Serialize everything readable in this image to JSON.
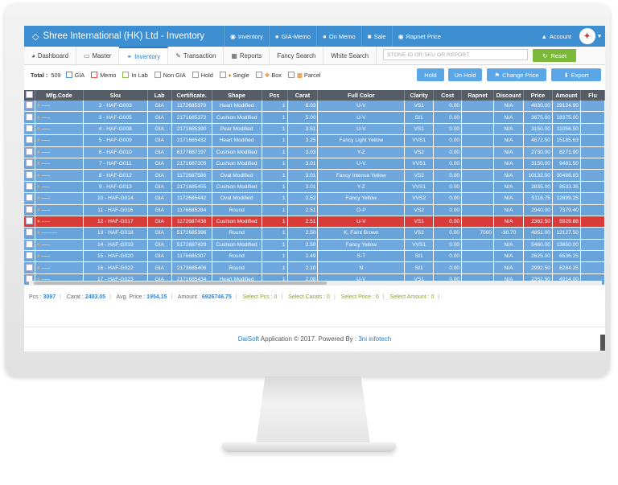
{
  "app": {
    "title": "Shree International (HK) Ltd - Inventory",
    "nav": [
      {
        "label": "Inventory",
        "icon": "eye-icon"
      },
      {
        "label": "GIA-Memo",
        "icon": "circle-icon"
      },
      {
        "label": "On Memo",
        "icon": "user-icon"
      },
      {
        "label": "Sale",
        "icon": "lock-icon"
      },
      {
        "label": "Rapnet Price",
        "icon": "eye-icon"
      }
    ],
    "account_label": "Account"
  },
  "tabs": [
    {
      "label": "Dashboard",
      "icon": "dashboard-icon",
      "active": false
    },
    {
      "label": "Master",
      "icon": "monitor-icon",
      "active": false
    },
    {
      "label": "Inventory",
      "icon": "binoculars-icon",
      "active": true
    },
    {
      "label": "Transaction",
      "icon": "edit-icon",
      "active": false
    },
    {
      "label": "Reports",
      "icon": "bar-chart-icon",
      "active": false
    },
    {
      "label": "Fancy Search",
      "icon": "",
      "active": false
    },
    {
      "label": "White Search",
      "icon": "",
      "active": false
    }
  ],
  "search": {
    "placeholder": "STONE ID OR SKU OR REPORT"
  },
  "reset_label": "Reset",
  "filters": {
    "total_label": "Total :",
    "total_value": "509",
    "checks": [
      {
        "label": "GIA",
        "color": "blue"
      },
      {
        "label": "Memo",
        "color": "red"
      },
      {
        "label": "In Lab",
        "color": "green"
      },
      {
        "label": "Non GIA",
        "color": "grey"
      },
      {
        "label": "Hold",
        "color": "grey"
      },
      {
        "label": "Single",
        "color": "grey",
        "icon": "gem"
      },
      {
        "label": "Box",
        "color": "grey",
        "icon": "box"
      },
      {
        "label": "Parcel",
        "color": "grey",
        "icon": "parcel"
      }
    ]
  },
  "actions": {
    "hold": "Hold",
    "unhold": "Un Hold",
    "change_price": "Change Price",
    "export": "Export"
  },
  "columns": [
    "Mfg.Code",
    "Sku",
    "Lab",
    "Certificate.",
    "Shape",
    "Pcs",
    "Carat",
    "Full Color",
    "Clarity",
    "Cost",
    "Rapnet",
    "Discount",
    "Price",
    "Amount",
    "Flu"
  ],
  "rows": [
    {
      "mfg": "-----",
      "sku": "2 - HAF-G003",
      "lab": "GIA",
      "cert": "1172685370",
      "shape": "Heart Modified",
      "pcs": "1",
      "carat": "6.03",
      "color": "U-V",
      "clarity": "VS1",
      "cost": "0.00",
      "rapnet": "",
      "discount": "N/A",
      "price": "4830.00",
      "amount": "29124.90",
      "hold": false
    },
    {
      "mfg": "-----",
      "sku": "3 - HAF-G005",
      "lab": "GIA",
      "cert": "2171685372",
      "shape": "Cushion Modified",
      "pcs": "1",
      "carat": "5.00",
      "color": "U-V",
      "clarity": "SI1",
      "cost": "0.00",
      "rapnet": "",
      "discount": "N/A",
      "price": "3675.00",
      "amount": "18375.00",
      "hold": false
    },
    {
      "mfg": "-----",
      "sku": "4 - HAF-G008",
      "lab": "GIA",
      "cert": "2171685390",
      "shape": "Pear Modified",
      "pcs": "1",
      "carat": "3.51",
      "color": "U-V",
      "clarity": "VS1",
      "cost": "0.00",
      "rapnet": "",
      "discount": "N/A",
      "price": "3150.00",
      "amount": "11056.50",
      "hold": false
    },
    {
      "mfg": "-----",
      "sku": "5 - HAF-G009",
      "lab": "GIA",
      "cert": "2171685432",
      "shape": "Heart Modified",
      "pcs": "1",
      "carat": "3.25",
      "color": "Fancy Light Yellow",
      "clarity": "VVS1",
      "cost": "0.00",
      "rapnet": "",
      "discount": "N/A",
      "price": "4672.50",
      "amount": "15185.63",
      "hold": false
    },
    {
      "mfg": "-----",
      "sku": "6 - HAF-G010",
      "lab": "GIA",
      "cert": "6177687197",
      "shape": "Cushion Modified",
      "pcs": "1",
      "carat": "3.03",
      "color": "Y-Z",
      "clarity": "VS2",
      "cost": "0.00",
      "rapnet": "",
      "discount": "N/A",
      "price": "2730.00",
      "amount": "8271.90",
      "hold": false
    },
    {
      "mfg": "-----",
      "sku": "7 - HAF-G011",
      "lab": "GIA",
      "cert": "2171687205",
      "shape": "Cushion Modified",
      "pcs": "1",
      "carat": "3.01",
      "color": "U-V",
      "clarity": "VVS1",
      "cost": "0.00",
      "rapnet": "",
      "discount": "N/A",
      "price": "3150.00",
      "amount": "9481.50",
      "hold": false
    },
    {
      "mfg": "-----",
      "sku": "8 - HAF-G012",
      "lab": "GIA",
      "cert": "1172687586",
      "shape": "Oval Modified",
      "pcs": "1",
      "carat": "3.01",
      "color": "Fancy Intense Yellow",
      "clarity": "VS2",
      "cost": "0.00",
      "rapnet": "",
      "discount": "N/A",
      "price": "10132.50",
      "amount": "30498.83",
      "hold": false
    },
    {
      "mfg": "-----",
      "sku": "9 - HAF-G013",
      "lab": "GIA",
      "cert": "2171685455",
      "shape": "Cushion Modified",
      "pcs": "1",
      "carat": "3.01",
      "color": "Y-Z",
      "clarity": "VVS1",
      "cost": "0.00",
      "rapnet": "",
      "discount": "N/A",
      "price": "2835.00",
      "amount": "8533.35",
      "hold": false
    },
    {
      "mfg": "-----",
      "sku": "10 - HAF-G014",
      "lab": "GIA",
      "cert": "1172685442",
      "shape": "Oval Modified",
      "pcs": "1",
      "carat": "2.52",
      "color": "Fancy Yellow",
      "clarity": "VVS2",
      "cost": "0.00",
      "rapnet": "",
      "discount": "N/A",
      "price": "5118.75",
      "amount": "12899.25",
      "hold": false
    },
    {
      "mfg": "-----",
      "sku": "11 - HAF-G016",
      "lab": "GIA",
      "cert": "1176685284",
      "shape": "Round",
      "pcs": "1",
      "carat": "2.51",
      "color": "O-P",
      "clarity": "VS2",
      "cost": "0.00",
      "rapnet": "",
      "discount": "N/A",
      "price": "2940.00",
      "amount": "7379.40",
      "hold": false
    },
    {
      "mfg": "-----",
      "sku": "12 - HAF-G017",
      "lab": "GIA",
      "cert": "1172687438",
      "shape": "Cushion Modified",
      "pcs": "1",
      "carat": "2.51",
      "color": "U-V",
      "clarity": "VS1",
      "cost": "0.00",
      "rapnet": "",
      "discount": "N/A",
      "price": "2362.50",
      "amount": "5929.88",
      "hold": true
    },
    {
      "mfg": "---------",
      "sku": "13 - HAF-G018",
      "lab": "GIA",
      "cert": "5172685396",
      "shape": "Round",
      "pcs": "1",
      "carat": "2.50",
      "color": "K, Faint Brown",
      "clarity": "VS2",
      "cost": "0.00",
      "rapnet": "7000",
      "discount": "-30.70",
      "price": "4851.00",
      "amount": "12127.50",
      "hold": false
    },
    {
      "mfg": "-----",
      "sku": "14 - HAF-G019",
      "lab": "GIA",
      "cert": "5172687429",
      "shape": "Cushion Modified",
      "pcs": "1",
      "carat": "2.50",
      "color": "Fancy Yellow",
      "clarity": "VVS1",
      "cost": "0.00",
      "rapnet": "",
      "discount": "N/A",
      "price": "5460.00",
      "amount": "13650.00",
      "hold": false
    },
    {
      "mfg": "-----",
      "sku": "15 - HAF-G020",
      "lab": "GIA",
      "cert": "1176685307",
      "shape": "Round",
      "pcs": "1",
      "carat": "2.49",
      "color": "S-T",
      "clarity": "SI1",
      "cost": "0.00",
      "rapnet": "",
      "discount": "N/A",
      "price": "2625.00",
      "amount": "6536.25",
      "hold": false
    },
    {
      "mfg": "-----",
      "sku": "16 - HAF-G022",
      "lab": "GIA",
      "cert": "2173685406",
      "shape": "Round",
      "pcs": "1",
      "carat": "2.10",
      "color": "N",
      "clarity": "SI1",
      "cost": "0.00",
      "rapnet": "",
      "discount": "N/A",
      "price": "2992.50",
      "amount": "6284.25",
      "hold": false
    },
    {
      "mfg": "-----",
      "sku": "17 - HAF-G023",
      "lab": "GIA",
      "cert": "2171685434",
      "shape": "Heart Modified",
      "pcs": "1",
      "carat": "2.08",
      "color": "U-V",
      "clarity": "VS1",
      "cost": "0.00",
      "rapnet": "",
      "discount": "N/A",
      "price": "2362.50",
      "amount": "4914.00",
      "hold": false
    }
  ],
  "summary": {
    "pcs_label": "Pcs :",
    "pcs": "3097",
    "carat_label": "Carat :",
    "carat": "2403.05",
    "avg_label": "Avg. Price :",
    "avg": "1954,15",
    "amount_label": "Amount :",
    "amount": "6926746.75",
    "sel_pcs": "Select Pcs :  0",
    "sel_carats": "Select Carats :  0",
    "sel_price": "Select Price :  0",
    "sel_amount": "Select Amount :  0"
  },
  "footer": {
    "dai": "DaiSoft",
    "middle": " Application © 2017. Powered By : ",
    "ini": "3ni infotech"
  }
}
